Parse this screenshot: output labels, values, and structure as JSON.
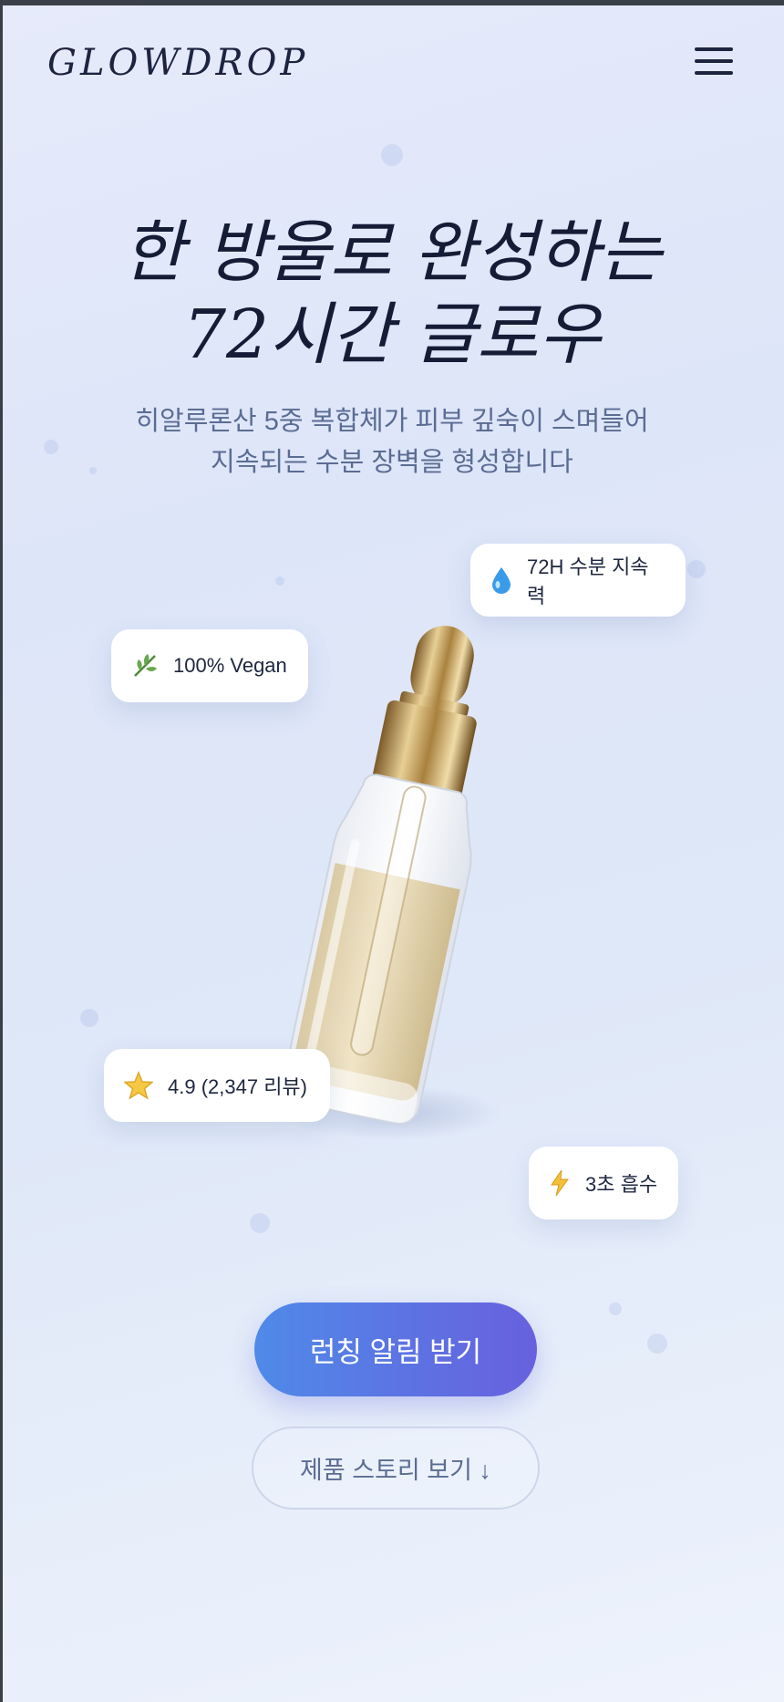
{
  "brand": {
    "logo": "GLOWDROP"
  },
  "header": {
    "menu_icon": "hamburger-menu-icon"
  },
  "hero": {
    "title_line1": "한 방울로 완성하는",
    "title_line2": "72시간 글로우",
    "subtitle_line1": "히알루론산 5중 복합체가 피부 깊숙이 스며들어",
    "subtitle_line2": "지속되는 수분 장벽을 형성합니다"
  },
  "badges": {
    "hydration": {
      "icon": "water-drop-icon",
      "label": "72H 수분 지속력"
    },
    "vegan": {
      "icon": "leaf-icon",
      "label": "100% Vegan"
    },
    "rating": {
      "icon": "star-icon",
      "label": "4.9 (2,347 리뷰)"
    },
    "absorb": {
      "icon": "lightning-icon",
      "label": "3초 흡수"
    }
  },
  "cta": {
    "primary_label": "런칭 알림 받기",
    "secondary_label": "제품 스토리 보기 ↓"
  },
  "colors": {
    "accent_start": "#4f8ae8",
    "accent_end": "#6860de",
    "heading": "#141c36",
    "subtext": "#5b6c93"
  }
}
